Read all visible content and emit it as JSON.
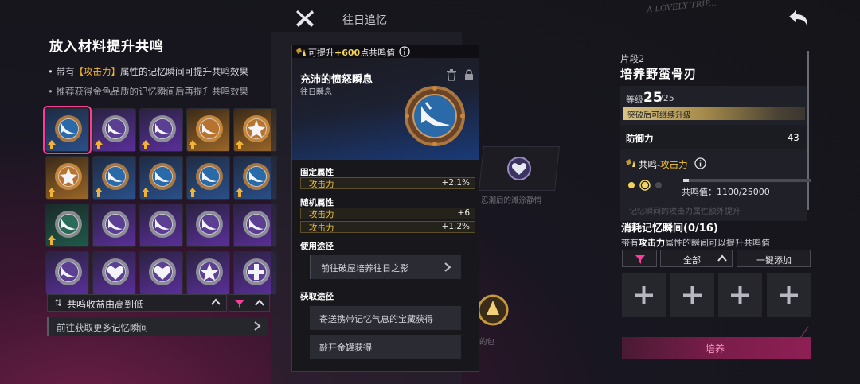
{
  "top": {
    "title": "往日追忆",
    "graffiti": "A LOVELY TRIP..."
  },
  "left": {
    "title": "放入材料提升共鸣",
    "note1_prefix": "带有",
    "note1_highlight": "【攻击力】",
    "note1_suffix": "属性的记忆瞬间可提升共鸣效果",
    "note2": "推荐获得金色品质的记忆瞬间后再提升共鸣效果",
    "grid": [
      {
        "frame": "blue",
        "icon": "sword-icon",
        "up": true,
        "selected": true
      },
      {
        "frame": "purple",
        "icon": "sword-icon",
        "up": true
      },
      {
        "frame": "purple",
        "icon": "sword-icon",
        "up": true
      },
      {
        "frame": "gold",
        "icon": "sword-icon",
        "up": true
      },
      {
        "frame": "gold",
        "icon": "star-icon",
        "up": true
      },
      {
        "frame": "gold",
        "icon": "star-icon",
        "up": true
      },
      {
        "frame": "blue",
        "icon": "sword-icon",
        "up": true
      },
      {
        "frame": "blue",
        "icon": "sword-icon",
        "up": true
      },
      {
        "frame": "blue",
        "icon": "sword-icon",
        "up": true
      },
      {
        "frame": "blue",
        "icon": "sword-icon",
        "up": true
      },
      {
        "frame": "teal",
        "icon": "sword-icon",
        "up": true
      },
      {
        "frame": "purple",
        "icon": "sword-icon",
        "up": false
      },
      {
        "frame": "purple",
        "icon": "sword-icon",
        "up": false
      },
      {
        "frame": "purple",
        "icon": "sword-icon",
        "up": false
      },
      {
        "frame": "purple",
        "icon": "sword-icon",
        "up": false
      },
      {
        "frame": "purple",
        "icon": "sword-icon",
        "up": false
      },
      {
        "frame": "purple",
        "icon": "heart-icon",
        "up": false
      },
      {
        "frame": "purple",
        "icon": "heart-icon",
        "up": false
      },
      {
        "frame": "purple",
        "icon": "star-icon",
        "up": false
      },
      {
        "frame": "purple",
        "icon": "plus-icon",
        "up": false
      }
    ],
    "sort_label": "共鸣收益由高到低",
    "goto_more": "前往获取更多记忆瞬间"
  },
  "middle": {
    "bg_text1": "忍潮后的滩涂静悄",
    "bg_text2": "的包"
  },
  "popup": {
    "head_prefix": "可提升",
    "head_value": "+600",
    "head_suffix": "点共鸣值",
    "name": "充沛的愤怒瞬息",
    "subtitle": "往日瞬息",
    "fixed_title": "固定属性",
    "fixed": [
      {
        "k": "攻击力",
        "v": "+2.1%"
      }
    ],
    "random_title": "随机属性",
    "random": [
      {
        "k": "攻击力",
        "v": "+6"
      },
      {
        "k": "攻击力",
        "v": "+1.2%"
      }
    ],
    "use_title": "使用途径",
    "use_btn": "前往破屋培养往日之影",
    "get_title": "获取途径",
    "get_btn1": "寄送携带记忆气息的宝藏获得",
    "get_btn2": "敲开金罐获得"
  },
  "right": {
    "fragment": "片段2",
    "name": "培养野蛮骨刃",
    "level_label": "等级",
    "level": "25",
    "level_max": "/25",
    "break_note": "突破后可继续升级",
    "def_label": "防御力",
    "def_value": "43",
    "res_prefix": "共鸣-",
    "res_stat": "攻击力",
    "res_value_text": "共鸣值：1100/25000",
    "res_progress": 0.044,
    "faded_line": "记忆瞬间的攻击力属性额外提升",
    "consume_title": "消耗记忆瞬间(0/16)",
    "consume_prefix": "带有",
    "consume_stat": "攻击力",
    "consume_suffix": "属性的瞬间可以提升共鸣值",
    "select_value": "全部",
    "auto_add": "一键添加",
    "train": "培养"
  },
  "colors": {
    "accent_gold": "#f2c233",
    "selected_border": "#ff3b9a",
    "train_button": "#8e1f54"
  }
}
